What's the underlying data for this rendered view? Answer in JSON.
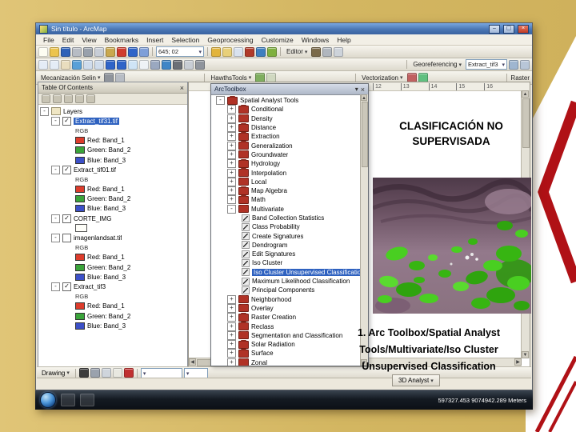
{
  "slide": {
    "title_lines": [
      "CLASIFICACIÓN NO",
      "SUPERVISADA"
    ],
    "caption_lines": [
      "1. Arc Toolbox/Spatial Analyst",
      "Tools/Multivariate/Iso Cluster",
      "Unsupervised Classification"
    ]
  },
  "arcmap": {
    "window_title": "Sin título - ArcMap",
    "menus": [
      "File",
      "Edit",
      "View",
      "Bookmarks",
      "Insert",
      "Selection",
      "Geoprocessing",
      "Customize",
      "Windows",
      "Help"
    ],
    "scale_value": "645; 02",
    "row1a_icons": [
      {
        "name": "new-document-icon",
        "color": "#fdfdf2"
      },
      {
        "name": "open-folder-icon",
        "color": "#ecc44d"
      },
      {
        "name": "save-icon",
        "color": "#2f62b8"
      },
      {
        "name": "print-icon",
        "color": "#b7bcc4"
      },
      {
        "name": "cut-icon",
        "color": "#98a0ab"
      },
      {
        "name": "copy-icon",
        "color": "#c7cdd6"
      },
      {
        "name": "paste-icon",
        "color": "#c9a84e"
      },
      {
        "name": "delete-icon",
        "color": "#cf3b2e"
      },
      {
        "name": "undo-icon",
        "color": "#2f64c8"
      },
      {
        "name": "redo-icon",
        "color": "#7f9fd8"
      }
    ],
    "row1b_icons": [
      {
        "name": "add-data-icon",
        "color": "#e2b43c"
      },
      {
        "name": "arccatalog-icon",
        "color": "#e8d07a"
      },
      {
        "name": "search-icon",
        "color": "#d8e2ef"
      },
      {
        "name": "arctoolbox-icon",
        "color": "#b03a2a"
      },
      {
        "name": "python-window-icon",
        "color": "#3f7fbf"
      },
      {
        "name": "modelbuilder-icon",
        "color": "#7fb03f"
      }
    ],
    "editor_label": "Editor",
    "editor_icons": [
      {
        "name": "editor-sketch-icon",
        "color": "#7a6a4a"
      },
      {
        "name": "editor-target-icon",
        "color": "#b0b6be"
      },
      {
        "name": "editor-attributes-icon",
        "color": "#cdd3da"
      }
    ],
    "row2_icons": [
      {
        "name": "zoom-in-icon",
        "color": "#e4ecf6"
      },
      {
        "name": "zoom-out-icon",
        "color": "#e4ecf6"
      },
      {
        "name": "pan-icon",
        "color": "#e9ddbe"
      },
      {
        "name": "full-extent-icon",
        "color": "#58a0d8"
      },
      {
        "name": "fixed-zoom-in-icon",
        "color": "#cfdcec"
      },
      {
        "name": "fixed-zoom-out-icon",
        "color": "#cfdcec"
      },
      {
        "name": "back-extent-icon",
        "color": "#2f64c8"
      },
      {
        "name": "forward-extent-icon",
        "color": "#2f64c8"
      },
      {
        "name": "select-features-icon",
        "color": "#cfe4f6"
      },
      {
        "name": "clear-selection-icon",
        "color": "#eef2f6"
      },
      {
        "name": "select-elements-icon",
        "color": "#9aa8c0"
      },
      {
        "name": "identify-icon",
        "color": "#3f86c6"
      },
      {
        "name": "find-icon",
        "color": "#6b6f76"
      },
      {
        "name": "go-to-xy-icon",
        "color": "#c8cdd4"
      },
      {
        "name": "measure-icon",
        "color": "#8f949c"
      }
    ],
    "georeferencing_label": "Georeferencing",
    "georeferencing_layer": "Extract_tif3",
    "georef_icons": [
      {
        "name": "georef-fit-icon",
        "color": "#9fb6d0"
      },
      {
        "name": "georef-rotate-icon",
        "color": "#b8c6d8"
      }
    ],
    "mecanizacion_label": "Mecanización Selin",
    "mecanizacion_icons": [
      {
        "name": "mecanizacion-tool-icon",
        "color": "#8f949c"
      },
      {
        "name": "mecanizacion-edit-icon",
        "color": "#b7bcc4"
      }
    ],
    "hawths_label": "HawthsTools",
    "hawths_icons": [
      {
        "name": "hawths-sample-icon",
        "color": "#7fae5f"
      },
      {
        "name": "hawths-analysis-icon",
        "color": "#d0d8c0"
      }
    ],
    "vectorization_label": "Vectorization",
    "vectorization_icons": [
      {
        "name": "vector-trace-icon",
        "color": "#c06060"
      },
      {
        "name": "raster-cleanup-icon",
        "color": "#60c080"
      }
    ],
    "raster_label": "Raster",
    "drawing_label": "Drawing",
    "drawing_icons": [
      {
        "name": "drawing-arrow-icon",
        "color": "#3c3c3c"
      },
      {
        "name": "rotate-element-icon",
        "color": "#9aa2ad"
      },
      {
        "name": "rectangle-tool-icon",
        "color": "#cfd5dc"
      },
      {
        "name": "text-tool-icon",
        "color": "#e8e8e0"
      },
      {
        "name": "font-color-icon",
        "color": "#c03030"
      }
    ],
    "analyst3d_label": "3D Analyst",
    "ruler_ticks": [
      "12",
      "13",
      "14",
      "15",
      "16"
    ],
    "taskbar_text": "597327.453 9074942.289 Meters"
  },
  "toc": {
    "header": "Table Of Contents",
    "mini_icons": [
      {
        "name": "list-by-drawing-order-icon",
        "color": "#c8c4b4"
      },
      {
        "name": "list-by-source-icon",
        "color": "#c8c4b4"
      },
      {
        "name": "list-by-visibility-icon",
        "color": "#c8c4b4"
      },
      {
        "name": "list-by-selection-icon",
        "color": "#c8c4b4"
      },
      {
        "name": "toc-options-icon",
        "color": "#c8c4b4"
      }
    ],
    "root_label": "Layers",
    "layers": [
      {
        "name": "Extract_tif31.tif",
        "sub_label": "RGB",
        "bands": [
          "Red: Band_1",
          "Green: Band_2",
          "Blue: Band_3"
        ]
      },
      {
        "name": "Extract_tif01.tif",
        "sub_label": "RGB",
        "bands": [
          "Red: Band_1",
          "Green: Band_2",
          "Blue: Band_3"
        ]
      },
      {
        "name": "CORTE_IMG"
      },
      {
        "name": "imagenlandsat.tif",
        "sub_label": "RGB",
        "bands": [
          "Red: Band_1",
          "Green: Band_2",
          "Blue: Band_3"
        ]
      },
      {
        "name": "Extract_tif3",
        "sub_label": "RGB",
        "bands": [
          "Red: Band_1",
          "Green: Band_2",
          "Blue: Band_3"
        ]
      }
    ]
  },
  "toolbox": {
    "panel_title": "ArcToolbox",
    "toolbox_label": "Spatial Analyst Tools",
    "categories_before": [
      "Conditional",
      "Density",
      "Distance",
      "Extraction",
      "Generalization",
      "Groundwater",
      "Hydrology",
      "Interpolation",
      "Local",
      "Map Algebra",
      "Math"
    ],
    "multivariate_label": "Multivariate",
    "tools_before": [
      "Band Collection Statistics",
      "Class Probability",
      "Create Signatures",
      "Dendrogram",
      "Edit Signatures",
      "Iso Cluster"
    ],
    "selected_tool": "Iso Cluster Unsupervised Classification",
    "tools_after": [
      "Maximum Likelihood Classification",
      "Principal Components"
    ],
    "categories_after": [
      "Neighborhood",
      "Overlay",
      "Raster Creation",
      "Reclass",
      "Segmentation and Classification",
      "Solar Radiation",
      "Surface",
      "Zonal"
    ]
  }
}
